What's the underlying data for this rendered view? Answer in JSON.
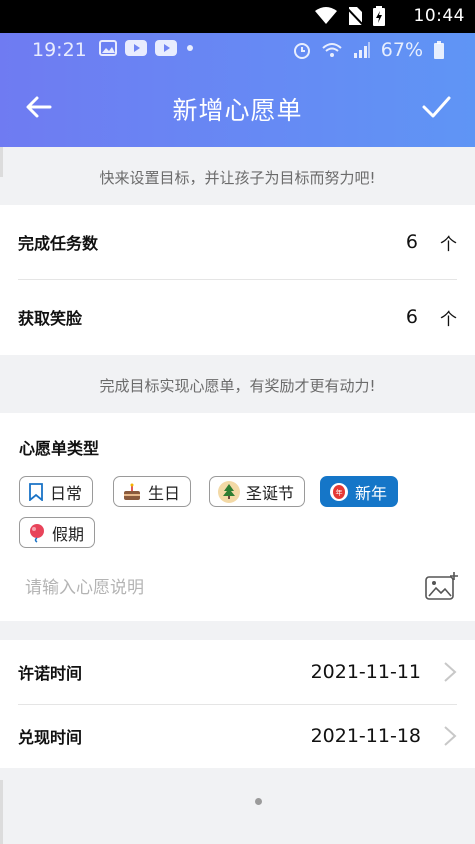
{
  "os_status": {
    "time": "10:44"
  },
  "phone_status": {
    "time": "19:21",
    "battery": "67%"
  },
  "header": {
    "title": "新增心愿单"
  },
  "tips": {
    "top": "快来设置目标，并让孩子为目标而努力吧!",
    "middle": "完成目标实现心愿单，有奖励才更有动力!"
  },
  "targets": {
    "tasks": {
      "label": "完成任务数",
      "value": "6",
      "unit": "个"
    },
    "smiles": {
      "label": "获取笑脸",
      "value": "6",
      "unit": "个"
    }
  },
  "wish_type": {
    "title": "心愿单类型",
    "chips": [
      {
        "label": "日常",
        "icon": "bookmark-icon",
        "active": false
      },
      {
        "label": "生日",
        "icon": "cake-icon",
        "active": false
      },
      {
        "label": "圣诞节",
        "icon": "christmas-tree-icon",
        "active": false
      },
      {
        "label": "新年",
        "icon": "lantern-icon",
        "active": true
      },
      {
        "label": "假期",
        "icon": "balloon-icon",
        "active": false
      }
    ],
    "active_color": "#1576c8"
  },
  "description": {
    "placeholder": "请输入心愿说明"
  },
  "dates": {
    "promise": {
      "label": "许诺时间",
      "value": "2021-11-11"
    },
    "redeem": {
      "label": "兑现时间",
      "value": "2021-11-18"
    }
  },
  "colors": {
    "header_start": "#6f7bf2",
    "header_end": "#5f95f5",
    "background": "#f1f2f4"
  }
}
